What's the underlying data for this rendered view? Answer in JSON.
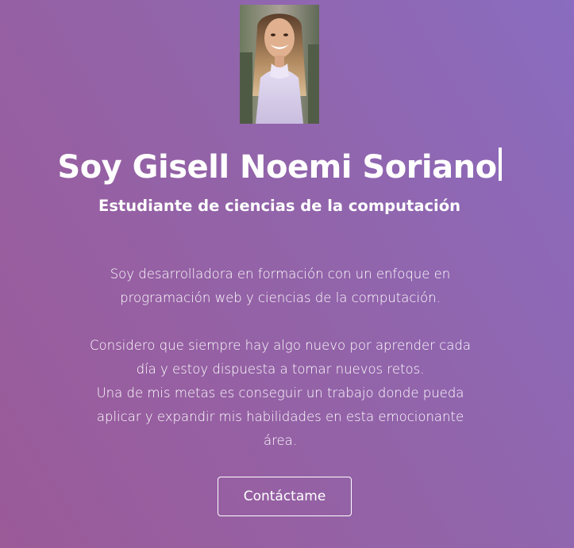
{
  "profile": {
    "photo_alt": "Foto de perfil",
    "name_heading": "Soy Gisell Noemi Soriano",
    "subtitle": "Estudiante de ciencias de la computación"
  },
  "bio": {
    "paragraph_1": "Soy desarrolladora en formación con un enfoque en programación web y ciencias de la computación.",
    "paragraph_2_line_1": "Considero que siempre hay algo nuevo por aprender cada día y estoy dispuesta a tomar nuevos retos.",
    "paragraph_2_line_2": "Una de mis metas es conseguir un trabajo donde pueda aplicar y expandir mis habilidades en esta emocionante área."
  },
  "actions": {
    "contact_label": "Contáctame"
  },
  "colors": {
    "gradient_start": "#9b5a98",
    "gradient_end": "#8a6cc0",
    "text": "#ffffff"
  }
}
